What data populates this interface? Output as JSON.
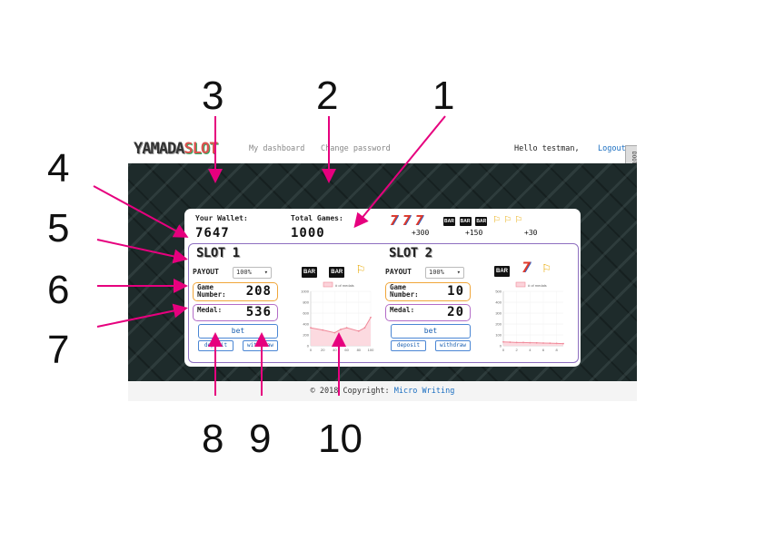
{
  "annotations": [
    "1",
    "2",
    "3",
    "4",
    "5",
    "6",
    "7",
    "8",
    "9",
    "10"
  ],
  "navbar": {
    "logo_a": "YAMADA",
    "logo_b": "SLOT",
    "link_dashboard": "My dashboard",
    "link_password": "Change password",
    "greeting": "Hello testman,",
    "logout": "Logout",
    "side_tab": "DOOT"
  },
  "wallet": {
    "label": "Your Wallet:",
    "value": "7647"
  },
  "total_games": {
    "label": "Total Games:",
    "value": "1000"
  },
  "paytable": [
    {
      "symbol": "777",
      "icons": [
        "7",
        "7",
        "7"
      ],
      "reward": "+300"
    },
    {
      "symbol": "BAR",
      "icons": [
        "BAR",
        "BAR",
        "BAR"
      ],
      "reward": "+150"
    },
    {
      "symbol": "bell",
      "icons": [
        "🔔",
        "🔔",
        "🔔"
      ],
      "reward": "+30"
    }
  ],
  "slots": [
    {
      "title": "SLOT 1",
      "payout_label": "PAYOUT",
      "payout_value": "100%",
      "reels": [
        "BAR",
        "BAR",
        "bell"
      ],
      "game_label_1": "Game",
      "game_label_2": "Number:",
      "game_value": "208",
      "medal_label": "Medal:",
      "medal_value": "536",
      "bet_label": "bet",
      "deposit_label": "deposit",
      "withdraw_label": "withdraw"
    },
    {
      "title": "SLOT 2",
      "payout_label": "PAYOUT",
      "payout_value": "100%",
      "reels": [
        "BAR",
        "7",
        "bell"
      ],
      "game_label_1": "Game",
      "game_label_2": "Number:",
      "game_value": "10",
      "medal_label": "Medal:",
      "medal_value": "20",
      "bet_label": "bet",
      "deposit_label": "deposit",
      "withdraw_label": "withdraw"
    }
  ],
  "footer": {
    "text": "© 2018 Copyright:",
    "link": "Micro Writing"
  },
  "chart_data": [
    {
      "type": "area",
      "legend": "# of medals",
      "x": [
        0,
        20,
        40,
        50,
        60,
        80,
        90,
        100
      ],
      "y": [
        330,
        290,
        240,
        300,
        330,
        270,
        330,
        520
      ],
      "xticks": [
        "0",
        "20",
        "40",
        "60",
        "80",
        "100"
      ],
      "yticks": [
        "0",
        "200",
        "400",
        "600",
        "800",
        "1000"
      ],
      "ylim": [
        0,
        1000
      ],
      "xlim": [
        0,
        100
      ],
      "color": "#f08a9a"
    },
    {
      "type": "area",
      "legend": "# of medals",
      "x": [
        0,
        1,
        2,
        3,
        4,
        5,
        6,
        7,
        8,
        9
      ],
      "y": [
        35,
        33,
        30,
        30,
        28,
        27,
        25,
        24,
        22,
        20
      ],
      "xticks": [
        "0",
        "2",
        "4",
        "6",
        "8"
      ],
      "yticks": [
        "0",
        "100",
        "200",
        "300",
        "400",
        "500"
      ],
      "ylim": [
        0,
        500
      ],
      "xlim": [
        0,
        9
      ],
      "color": "#f08a9a"
    }
  ]
}
